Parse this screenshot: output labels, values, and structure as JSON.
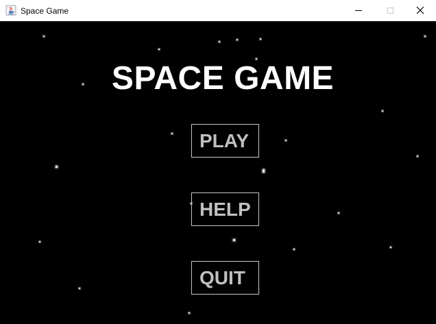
{
  "window": {
    "title": "Space Game",
    "icon": "java-coffee-cup-icon",
    "controls": [
      "minimize-icon",
      "maximize-icon",
      "close-icon"
    ]
  },
  "game": {
    "title": "SPACE GAME",
    "menu": {
      "play_label": "PLAY",
      "help_label": "HELP",
      "quit_label": "QUIT"
    },
    "colors": {
      "background": "#000000",
      "title": "#ffffff",
      "button_text": "#c0c0c0",
      "button_border": "#c8c8c8",
      "stars": "#e8e8e8"
    }
  }
}
